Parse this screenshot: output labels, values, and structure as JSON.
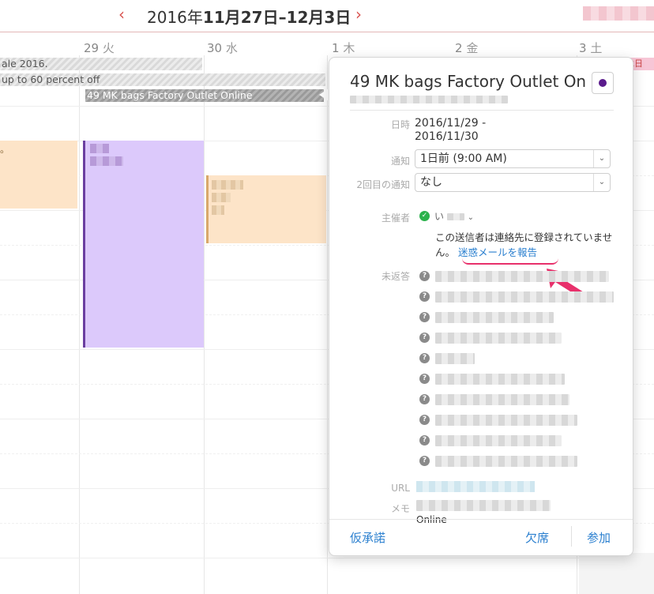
{
  "header": {
    "prev_icon": "‹",
    "next_icon": "›",
    "title_prefix": "2016年",
    "title_bold": "11月27日–12月3日"
  },
  "days": [
    {
      "num": "29",
      "wd": "火"
    },
    {
      "num": "30",
      "wd": "水"
    },
    {
      "num": "1",
      "wd": "木"
    },
    {
      "num": "2",
      "wd": "金"
    },
    {
      "num": "3",
      "wd": "土"
    }
  ],
  "all_day_events": [
    "ale 2016.",
    "up to 60 percent off",
    "49 MK bags Factory Outlet Online"
  ],
  "calendar_fragments": {
    "pink_tag": "木日",
    "peach_char": "。"
  },
  "popover": {
    "title": "49 MK bags Factory Outlet On",
    "date_label": "日時",
    "date_line1": "2016/11/29 -",
    "date_line2": "2016/11/30",
    "alert_label": "通知",
    "alert_value": "1日前 (9:00 AM)",
    "alert2_label": "2回目の通知",
    "alert2_value": "なし",
    "organizer_label": "主催者",
    "organizer_name": "い",
    "warning_text": "この送信者は連絡先に登録されていません。",
    "spam_link": "迷惑メールを報告",
    "no_reply_label": "未返答",
    "url_label": "URL",
    "memo_label": "メモ",
    "memo_text": "Online",
    "tentative_btn": "仮承諾",
    "decline_btn": "欠席",
    "accept_btn": "参加",
    "chevron": "⌄"
  },
  "colors": {
    "accent": "#d9534f",
    "link": "#2a7fcf",
    "calendar_purple": "#5a1b8c",
    "annotation_pink": "#e8306b"
  }
}
